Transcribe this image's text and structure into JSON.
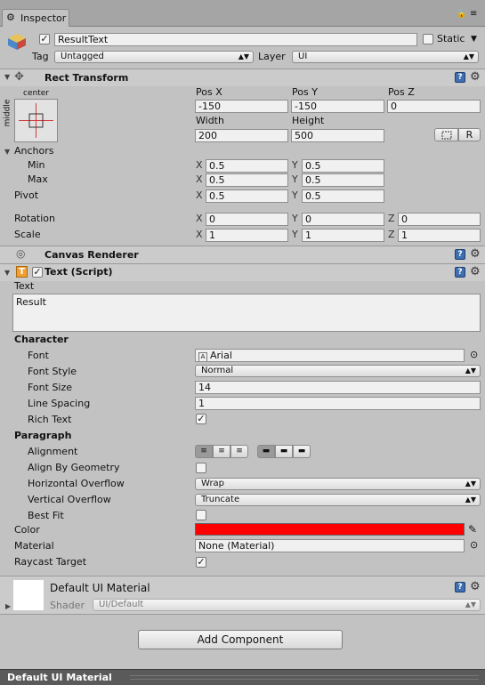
{
  "tab": {
    "title": "Inspector"
  },
  "object": {
    "name": "ResultText",
    "active": true,
    "static_label": "Static",
    "tag_label": "Tag",
    "tag_value": "Untagged",
    "layer_label": "Layer",
    "layer_value": "UI"
  },
  "rect": {
    "title": "Rect Transform",
    "anchor_h": "center",
    "anchor_v": "middle",
    "posx_label": "Pos X",
    "posy_label": "Pos Y",
    "posz_label": "Pos Z",
    "posx": "-150",
    "posy": "-150",
    "posz": "0",
    "width_label": "Width",
    "height_label": "Height",
    "width": "200",
    "height": "500",
    "r_button": "R",
    "anchors_label": "Anchors",
    "min_label": "Min",
    "min_x": "0.5",
    "min_y": "0.5",
    "max_label": "Max",
    "max_x": "0.5",
    "max_y": "0.5",
    "pivot_label": "Pivot",
    "pivot_x": "0.5",
    "pivot_y": "0.5",
    "rotation_label": "Rotation",
    "rot_x": "0",
    "rot_y": "0",
    "rot_z": "0",
    "scale_label": "Scale",
    "scale_x": "1",
    "scale_y": "1",
    "scale_z": "1",
    "x": "X",
    "y": "Y",
    "z": "Z"
  },
  "canvas_renderer": {
    "title": "Canvas Renderer"
  },
  "text_script": {
    "title": "Text (Script)",
    "text_label": "Text",
    "text_value": "Result",
    "character_label": "Character",
    "font_label": "Font",
    "font_value": "Arial",
    "font_style_label": "Font Style",
    "font_style_value": "Normal",
    "font_size_label": "Font Size",
    "font_size_value": "14",
    "line_spacing_label": "Line Spacing",
    "line_spacing_value": "1",
    "rich_text_label": "Rich Text",
    "rich_text_checked": true,
    "paragraph_label": "Paragraph",
    "alignment_label": "Alignment",
    "align_geom_label": "Align By Geometry",
    "h_overflow_label": "Horizontal Overflow",
    "h_overflow_value": "Wrap",
    "v_overflow_label": "Vertical Overflow",
    "v_overflow_value": "Truncate",
    "best_fit_label": "Best Fit",
    "color_label": "Color",
    "color_value": "#ff0000",
    "material_label": "Material",
    "material_value": "None (Material)",
    "raycast_label": "Raycast Target"
  },
  "material_preview": {
    "name": "Default UI Material",
    "shader_label": "Shader",
    "shader_value": "UI/Default"
  },
  "add_component": "Add Component",
  "bottom_bar": {
    "label": "Default UI Material"
  },
  "colors": {
    "accent_blue": "#3e6fb0",
    "panel": "#c2c2c2"
  }
}
